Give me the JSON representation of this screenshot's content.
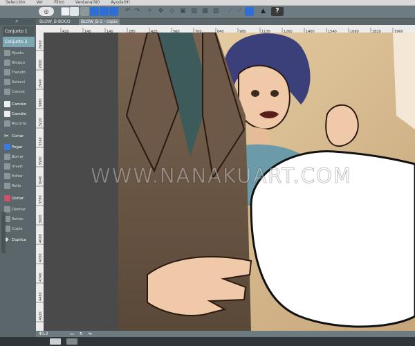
{
  "menu": [
    "Selección",
    "Ver",
    "Filtro",
    "Ventana(W)",
    "Ayuda(H)"
  ],
  "tabs": [
    {
      "label": "BLOW_B-BOCO",
      "active": false
    },
    {
      "label": "BLOW_B-1 - copia",
      "active": true
    }
  ],
  "sets": [
    "Conjunto 1",
    "Conjunto 2"
  ],
  "tools": [
    {
      "label": "Ajusto",
      "icon": "adjust-icon"
    },
    {
      "label": "Bloquo",
      "icon": "lock-icon"
    },
    {
      "label": "Transfo",
      "icon": "transform-icon"
    },
    {
      "label": "Selecci",
      "icon": "selection-icon"
    },
    {
      "label": "Cancel",
      "icon": "cancel-icon"
    },
    {
      "label": "Cambio",
      "icon": "switch-icon"
    },
    {
      "label": "Cambio",
      "icon": "switch-icon"
    },
    {
      "label": "Recorto",
      "icon": "crop-icon"
    },
    {
      "label": "Cortar",
      "icon": "scissors-icon"
    },
    {
      "label": "Pegar",
      "icon": "paste-icon"
    },
    {
      "label": "Borrar",
      "icon": "erase-icon"
    },
    {
      "label": "Invert",
      "icon": "invert-icon"
    },
    {
      "label": "Editar",
      "icon": "edit-icon"
    },
    {
      "label": "Relle",
      "icon": "fill-icon"
    },
    {
      "label": "Quitar",
      "icon": "remove-icon"
    },
    {
      "label": "Deshac",
      "icon": "undo-icon"
    },
    {
      "label": "Rehac",
      "icon": "redo-icon"
    },
    {
      "label": "Copia",
      "icon": "copy-icon"
    },
    {
      "label": "Duplica",
      "icon": "duplicate-icon"
    }
  ],
  "ruler_top": [
    "420",
    "140",
    "140",
    "280",
    "420",
    "560",
    "700",
    "840",
    "980",
    "1120",
    "1260",
    "1400",
    "1540",
    "1680",
    "1820",
    "1960"
  ],
  "ruler_left": [
    "2660",
    "2800",
    "2940",
    "3080",
    "3220",
    "3360",
    "3500",
    "3640",
    "3780",
    "3920",
    "4060",
    "4200",
    "4340",
    "4480",
    "4620"
  ],
  "watermark": "WWW.NANAKUART.COM",
  "zoom": "40.3",
  "colors": {
    "toolbar": "#6e7b80",
    "panel": "#5b666a",
    "active_set": "#7fa6b3"
  }
}
